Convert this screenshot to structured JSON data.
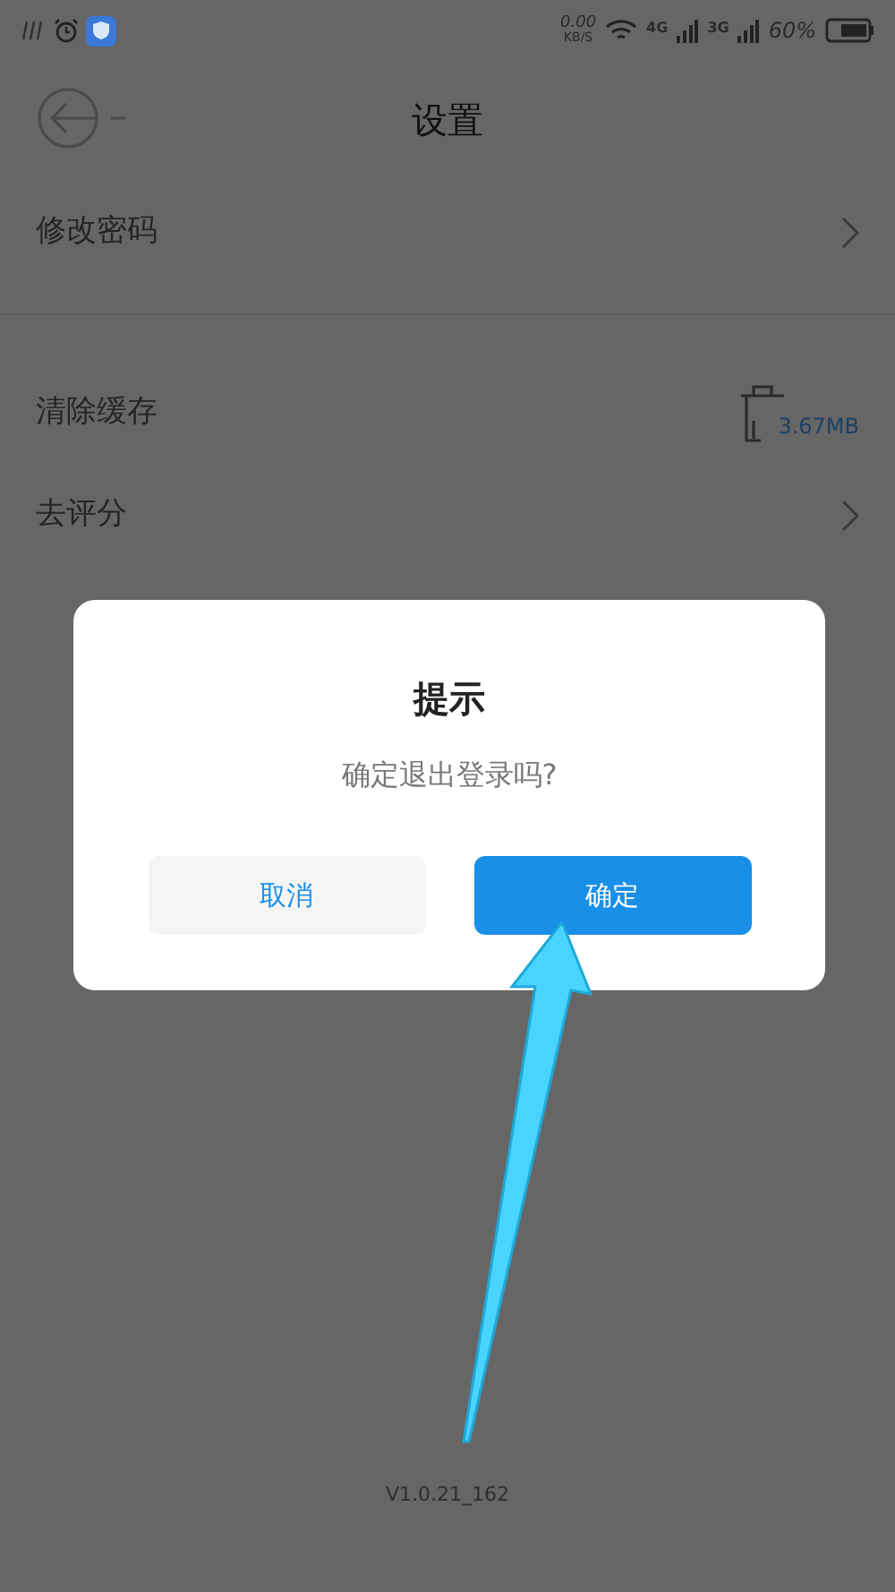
{
  "status_bar": {
    "speed": "0.00",
    "speed_unit": "KB/S",
    "network_1": "4G",
    "network_2": "3G",
    "battery": "60%"
  },
  "header": {
    "title": "设置"
  },
  "settings": [
    {
      "kind": "link",
      "label": "修改密码"
    },
    {
      "kind": "cache",
      "label": "清除缓存",
      "value": "3.67MB"
    },
    {
      "kind": "link",
      "label": "去评分"
    }
  ],
  "dialog": {
    "title": "提示",
    "message": "确定退出登录吗?",
    "buttons": [
      {
        "label": "取消",
        "kind": "cancel"
      },
      {
        "label": "确定",
        "kind": "confirm"
      }
    ]
  },
  "version": "V1.0.21_162"
}
